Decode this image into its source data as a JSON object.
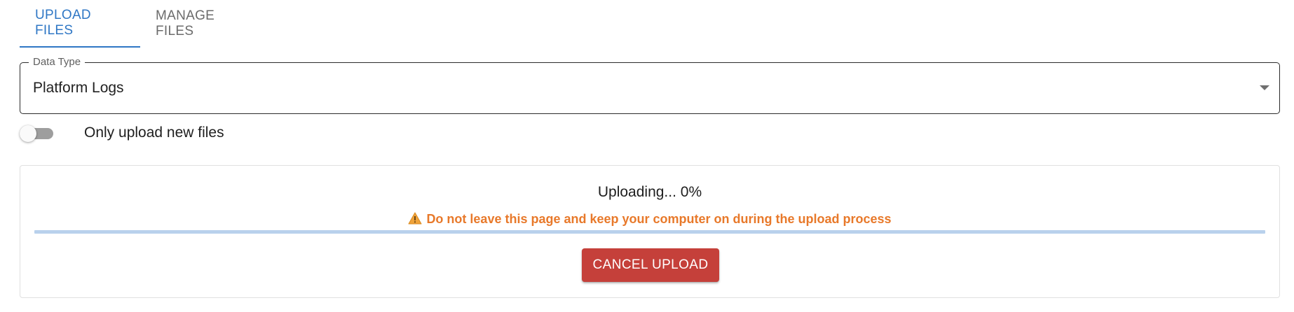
{
  "tabs": [
    {
      "label": "UPLOAD FILES",
      "active": true
    },
    {
      "label": "MANAGE FILES",
      "active": false
    }
  ],
  "data_type": {
    "label": "Data Type",
    "value": "Platform Logs"
  },
  "toggle": {
    "label": "Only upload new files",
    "checked": false
  },
  "upload": {
    "status": "Uploading... 0%",
    "progress_percent": 0,
    "warning": "Do not leave this page and keep your computer on during the upload process",
    "cancel_label": "CANCEL UPLOAD"
  },
  "colors": {
    "accent": "#2f77c5",
    "warning": "#e8792a",
    "danger": "#c5403a"
  },
  "icons": {
    "warning": "warning-icon",
    "dropdown": "chevron-down-icon"
  }
}
